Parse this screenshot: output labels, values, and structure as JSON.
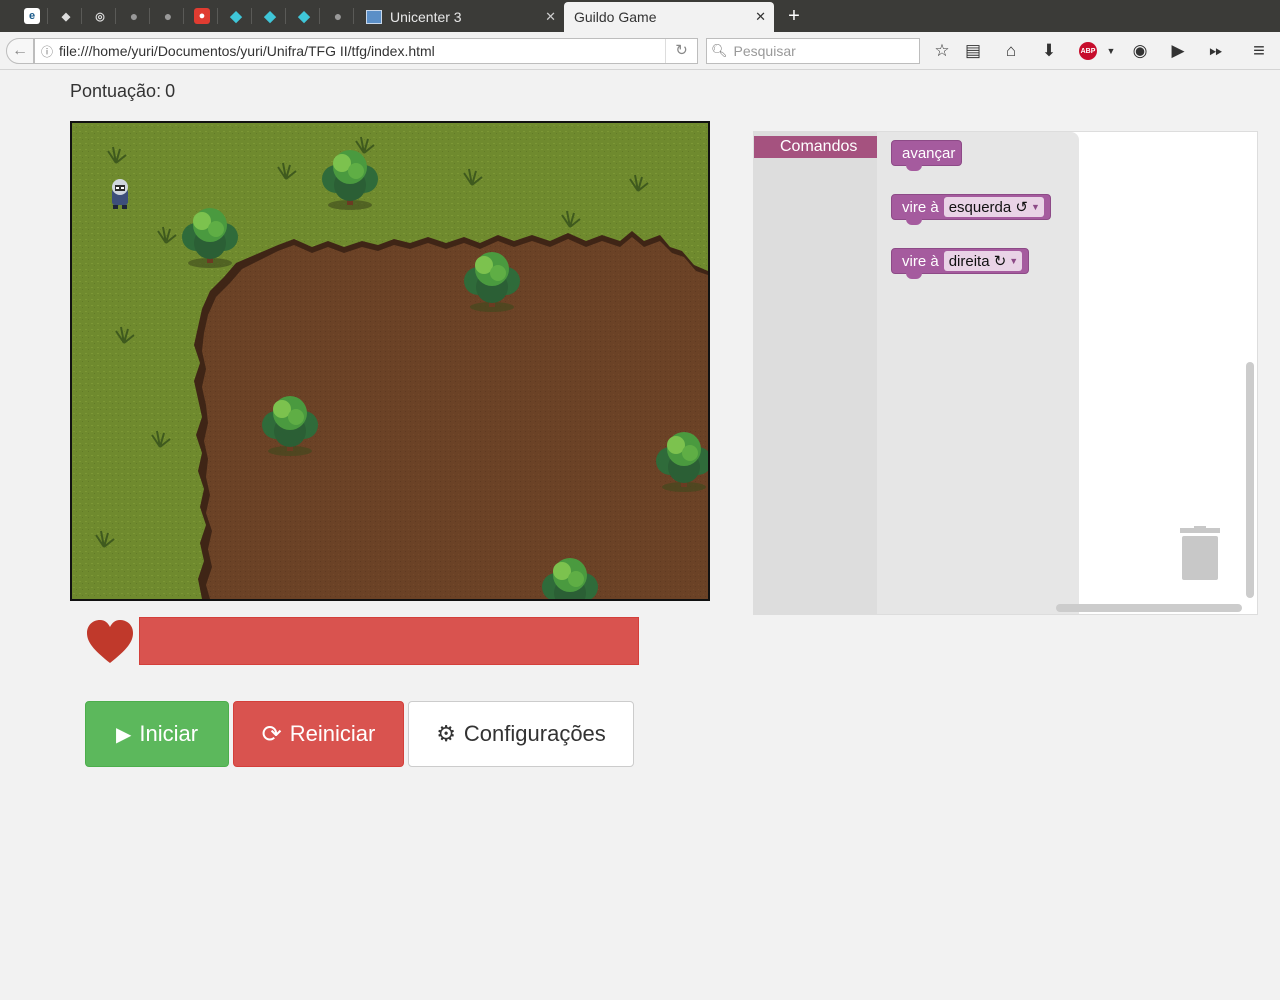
{
  "browser": {
    "tabs": [
      {
        "title": "Unicenter 3",
        "active": false
      },
      {
        "title": "Guildo Game",
        "active": true
      }
    ],
    "url": "file:///home/yuri/Documentos/yuri/Unifra/TFG II/tfg/index.html",
    "search_placeholder": "Pesquisar",
    "abp_label": "ABP"
  },
  "page": {
    "score_label": "Pontuação:",
    "score_value": "0",
    "health_fraction": 1.0,
    "buttons": {
      "start": "Iniciar",
      "reset": "Reiniciar",
      "config": "Configurações"
    }
  },
  "blockly": {
    "category": "Comandos",
    "blocks": [
      {
        "text": "avançar"
      },
      {
        "text": "vire à",
        "option": "esquerda ↺"
      },
      {
        "text": "vire à",
        "option": "direita ↻"
      }
    ]
  },
  "colors": {
    "start": "#5cb85c",
    "danger": "#d9534f",
    "block": "#a55b9e",
    "category": "#a5527f",
    "grass": "#6f8a2e",
    "dirt": "#6b4226"
  }
}
